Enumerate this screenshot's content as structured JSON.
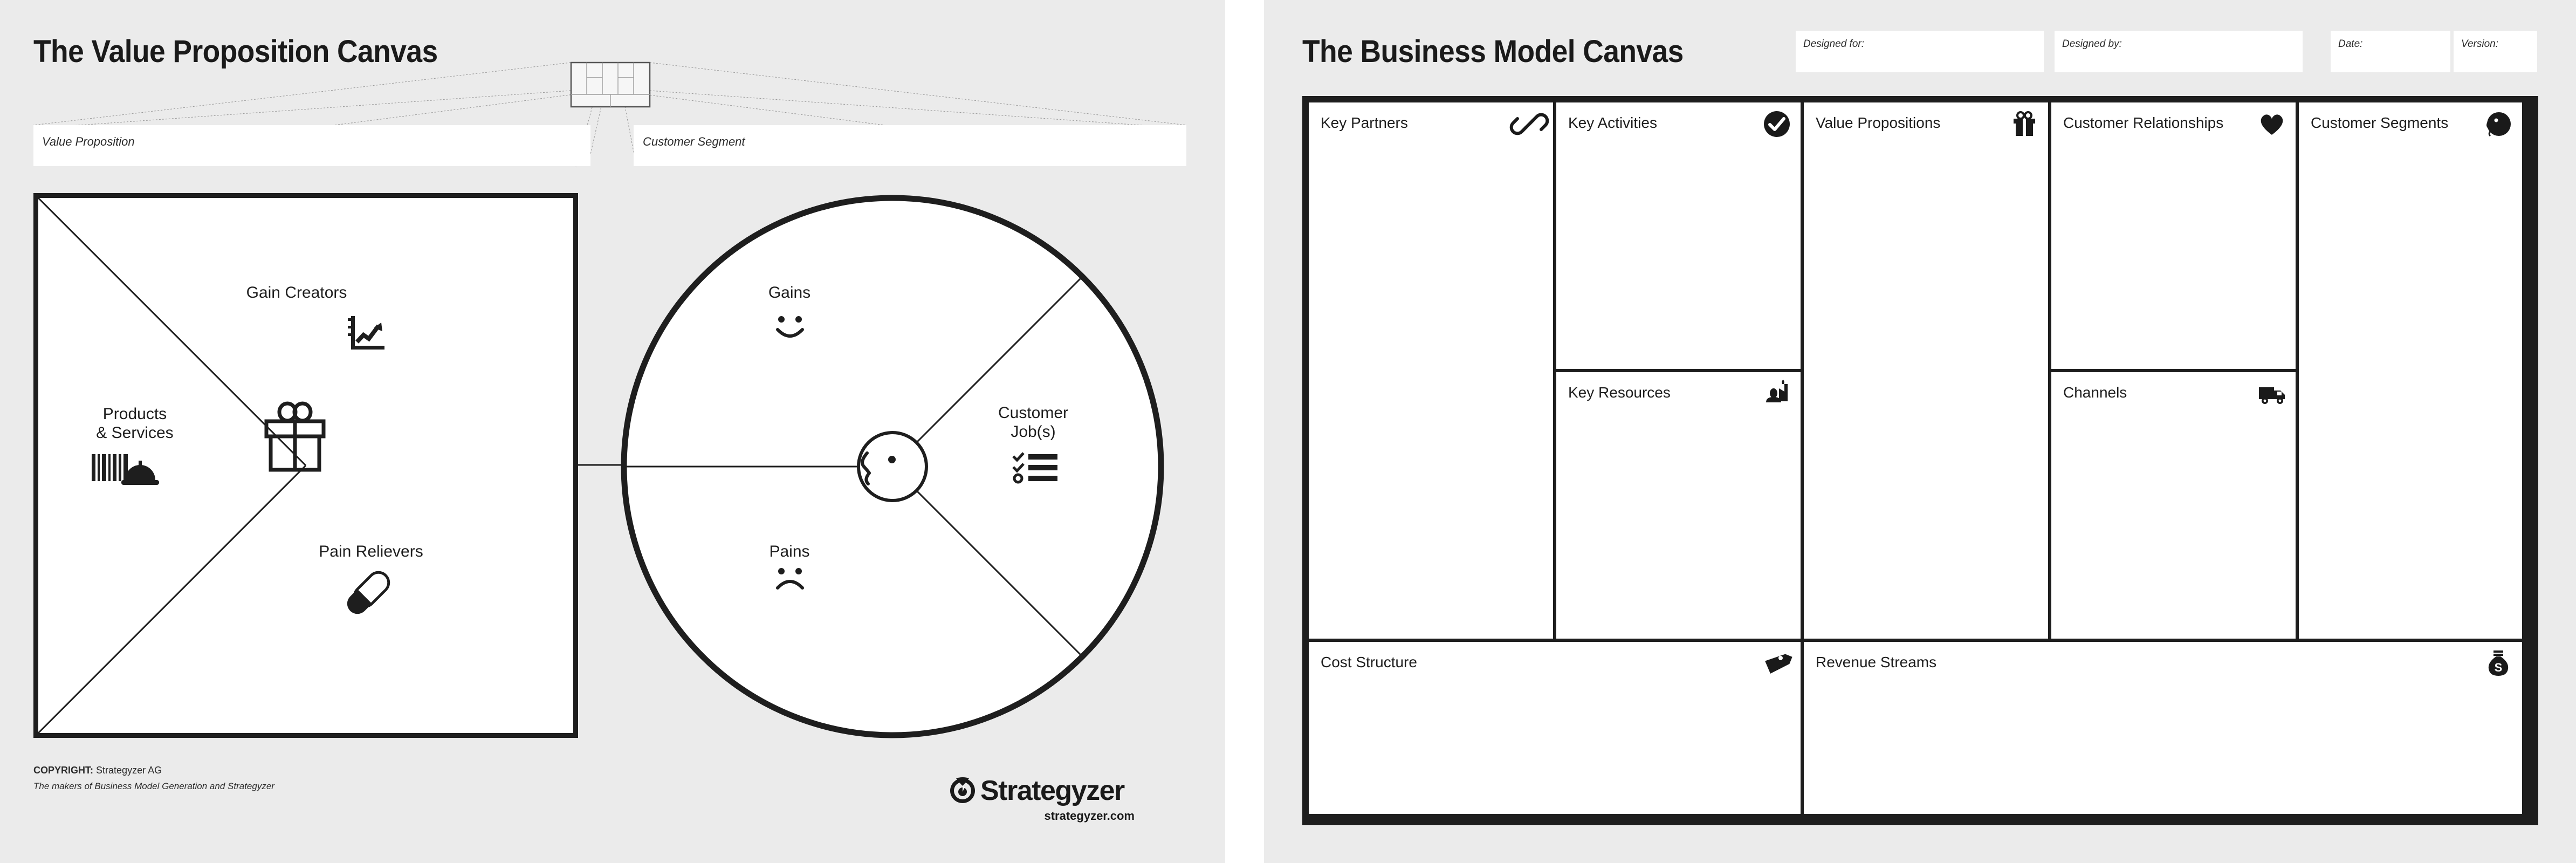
{
  "value_proposition_canvas": {
    "title": "The Value Proposition Canvas",
    "header_fields": [
      {
        "label": "Value Proposition",
        "value": ""
      },
      {
        "label": "Customer Segment",
        "value": ""
      }
    ],
    "value_map": {
      "blocks": [
        {
          "label": "Gain Creators",
          "icon": "growth-chart-icon"
        },
        {
          "label": "Products\n& Services",
          "icon": "barcode-dish-icon"
        },
        {
          "label": "Pain Relievers",
          "icon": "pill-icon"
        }
      ],
      "center_icon": "gift-icon"
    },
    "customer_profile": {
      "blocks": [
        {
          "label": "Gains",
          "icon": "smiley-face-icon"
        },
        {
          "label": "Customer\nJob(s)",
          "icon": "checklist-icon"
        },
        {
          "label": "Pains",
          "icon": "frowny-face-icon"
        }
      ],
      "center_icon": "customer-head-icon"
    },
    "thumbnail_icon": "business-model-canvas-thumbnail",
    "footer": {
      "copyright_prefix": "COPYRIGHT:",
      "copyright_owner": "Strategyzer AG",
      "tagline": "The makers of Business Model Generation and Strategyzer",
      "brand": "Strategyzer",
      "brand_icon": "strategyzer-owl-icon",
      "url": "strategyzer.com"
    }
  },
  "business_model_canvas": {
    "title": "The Business Model Canvas",
    "header_fields": [
      {
        "label": "Designed for:",
        "value": ""
      },
      {
        "label": "Designed by:",
        "value": ""
      },
      {
        "label": "Date:",
        "value": ""
      },
      {
        "label": "Version:",
        "value": ""
      }
    ],
    "cells": [
      {
        "label": "Key Partners",
        "icon": "chain-link-icon",
        "value": ""
      },
      {
        "label": "Key Activities",
        "icon": "check-circle-icon",
        "value": ""
      },
      {
        "label": "Key Resources",
        "icon": "factory-icon",
        "value": ""
      },
      {
        "label": "Value Propositions",
        "icon": "gift-icon",
        "value": ""
      },
      {
        "label": "Customer Relationships",
        "icon": "heart-icon",
        "value": ""
      },
      {
        "label": "Channels",
        "icon": "truck-icon",
        "value": ""
      },
      {
        "label": "Customer Segments",
        "icon": "customer-head-icon",
        "value": ""
      },
      {
        "label": "Cost Structure",
        "icon": "price-tag-icon",
        "value": ""
      },
      {
        "label": "Revenue Streams",
        "icon": "money-bag-icon",
        "value": ""
      }
    ]
  },
  "colors": {
    "panel_background": "#ebebeb",
    "page_background": "#ffffff",
    "ink": "#1e1e1e",
    "field_background": "#ffffff"
  }
}
